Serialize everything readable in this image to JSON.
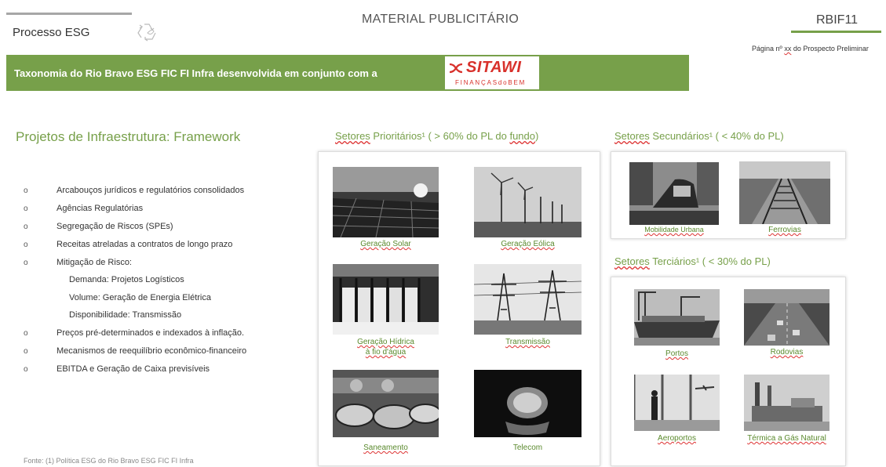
{
  "header": {
    "process": "Processo ESG",
    "title": "MATERIAL PUBLICITÁRIO",
    "code": "RBIF11",
    "page_prefix": "Página nº ",
    "page_placeholder": "xx",
    "page_suffix": " do Prospecto Preliminar"
  },
  "banner": {
    "text": "Taxonomia do Rio Bravo ESG FIC FI Infra desenvolvida em conjunto com a",
    "logo_word": "SITAWI",
    "logo_sub": "FINANÇASdoBEM"
  },
  "framework": {
    "title": "Projetos de Infraestrutura: Framework",
    "bullet": "o",
    "items": [
      "Arcabouços jurídicos e regulatórios consolidados",
      "Agências Regulatórias",
      "Segregação de Riscos (SPEs)",
      "Receitas atreladas a contratos de longo prazo",
      "Mitigação de Risco:",
      "Preços pré-determinados e indexados à inflação.",
      "Mecanismos de reequilíbrio econômico-financeiro",
      "EBITDA e Geração de Caixa previsíveis"
    ],
    "subitems": [
      "Demanda: Projetos Logísticos",
      "Volume: Geração de Energia Elétrica",
      "Disponibilidade: Transmissão"
    ],
    "source": "Fonte: (1) Política ESG do Rio Bravo ESG FIC FI Infra"
  },
  "prioritarios": {
    "title_a": "Setores",
    "title_b": " Prioritários¹ ( > 60% do PL do ",
    "title_c": "fundo",
    "title_d": ")",
    "items": [
      "Geração Solar",
      "Geração Eólica",
      "Geração Hídrica",
      "à fio d'água",
      "Transmissão",
      "Saneamento",
      "Telecom"
    ]
  },
  "secundarios": {
    "title_a": "Setores",
    "title_b": " Secundários¹ ( < 40% do PL)",
    "items": [
      "Mobilidade Urbana",
      "Ferrovias"
    ]
  },
  "terciarios": {
    "title_a": "Setores",
    "title_b": " Terciários¹ ( < 30% do PL)",
    "items": [
      "Portos",
      "Rodovias",
      "Aeroportos",
      "Térmica a Gás Natural"
    ]
  },
  "colors": {
    "green": "#77a04a",
    "logo_red": "#d8312b"
  }
}
